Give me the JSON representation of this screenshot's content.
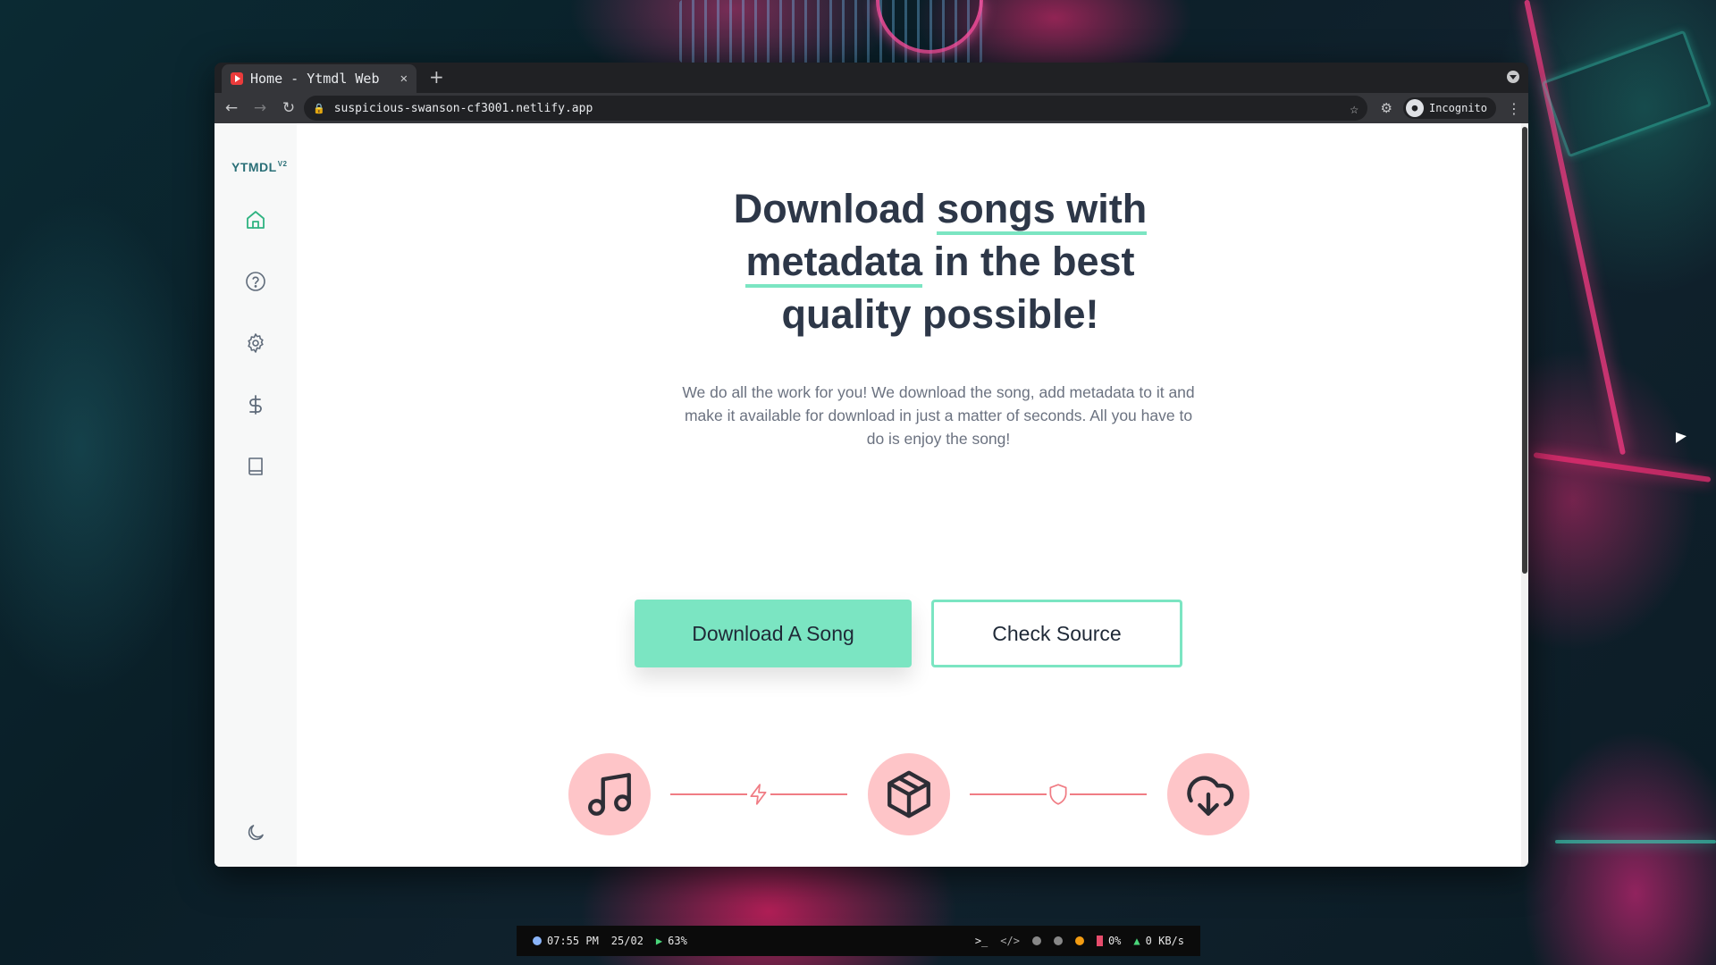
{
  "browser": {
    "tab_title": "Home - Ytmdl Web",
    "tab_close": "✕",
    "new_tab": "+",
    "url": "suspicious-swanson-cf3001.netlify.app",
    "incognito_label": "Incognito"
  },
  "sidebar": {
    "logo": "YTMDL",
    "logo_version": "V2",
    "items": [
      {
        "name": "home",
        "icon": "home-icon",
        "active": true
      },
      {
        "name": "help",
        "icon": "help-circle-icon",
        "active": false
      },
      {
        "name": "settings",
        "icon": "gear-icon",
        "active": false
      },
      {
        "name": "donate",
        "icon": "dollar-icon",
        "active": false
      },
      {
        "name": "docs",
        "icon": "book-icon",
        "active": false
      }
    ],
    "theme_toggle_icon": "moon-icon"
  },
  "hero": {
    "title_part1": "Download ",
    "title_highlight1": "songs with",
    "title_highlight2": "metadata",
    "title_part2": " in the best quality possible!",
    "description": "We do all the work for you! We download the song, add metadata to it and make it available for download in just a matter of seconds. All you have to do is enjoy the song!",
    "primary_button": "Download A Song",
    "secondary_button": "Check Source"
  },
  "features": {
    "steps": [
      "music-icon",
      "box-icon",
      "cloud-download-icon"
    ],
    "connectors": [
      "zap-icon",
      "shield-icon"
    ]
  },
  "taskbar": {
    "time": "07:55 PM",
    "date": "25/02",
    "volume": "63%",
    "battery": "0%",
    "network": "0 KB/s"
  },
  "colors": {
    "accent": "#7be5c2",
    "feature_circle": "#fec5c8",
    "connector": "#f07c84",
    "active_icon": "#2fb381"
  }
}
